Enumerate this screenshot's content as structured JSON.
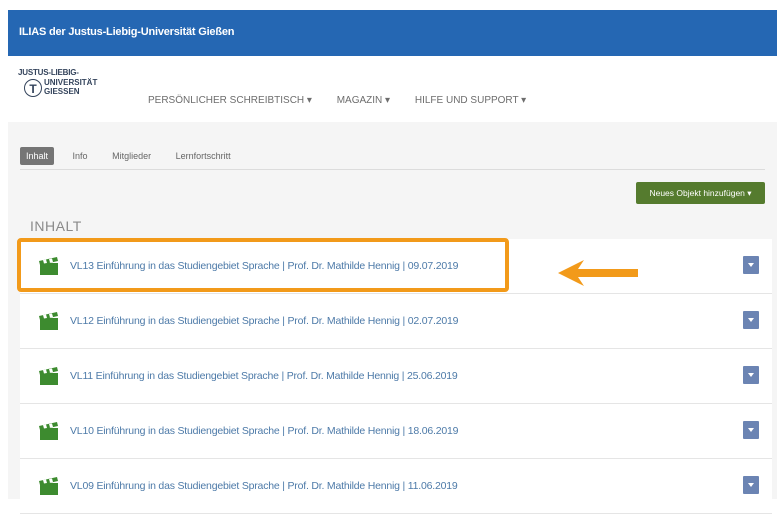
{
  "app": {
    "title": "ILIAS der Justus-Liebig-Universität Gießen"
  },
  "logo": {
    "line1": "JUSTUS-LIEBIG-",
    "line2": "UNIVERSITÄT",
    "line3": "GIESSEN",
    "mark": "T"
  },
  "nav": [
    {
      "label": "PERSÖNLICHER SCHREIBTISCH ▾"
    },
    {
      "label": "MAGAZIN ▾"
    },
    {
      "label": "HILFE UND SUPPORT ▾"
    }
  ],
  "tabs": [
    {
      "label": "Inhalt",
      "active": true
    },
    {
      "label": "Info",
      "active": false
    },
    {
      "label": "Mitglieder",
      "active": false
    },
    {
      "label": "Lernfortschritt",
      "active": false
    }
  ],
  "actions": {
    "add_object": "Neues Objekt hinzufügen ▾"
  },
  "section": {
    "title": "INHALT"
  },
  "items": [
    {
      "label": "VL13 Einführung in das Studiengebiet Sprache | Prof. Dr. Mathilde Hennig | 09.07.2019",
      "icon": "clapperboard-icon"
    },
    {
      "label": "VL12 Einführung in das Studiengebiet Sprache | Prof. Dr. Mathilde Hennig | 02.07.2019",
      "icon": "clapperboard-icon"
    },
    {
      "label": "VL11 Einführung in das Studiengebiet Sprache | Prof. Dr. Mathilde Hennig | 25.06.2019",
      "icon": "clapperboard-icon"
    },
    {
      "label": "VL10 Einführung in das Studiengebiet Sprache | Prof. Dr. Mathilde Hennig | 18.06.2019",
      "icon": "clapperboard-icon"
    },
    {
      "label": "VL09 Einführung in das Studiengebiet Sprache | Prof. Dr. Mathilde Hennig | 11.06.2019",
      "icon": "clapperboard-icon"
    }
  ],
  "colors": {
    "topbar": "#2567b3",
    "link": "#4d7aa8",
    "add_button": "#557b2e",
    "highlight": "#f29a1a",
    "menu": "#6b84b3"
  }
}
